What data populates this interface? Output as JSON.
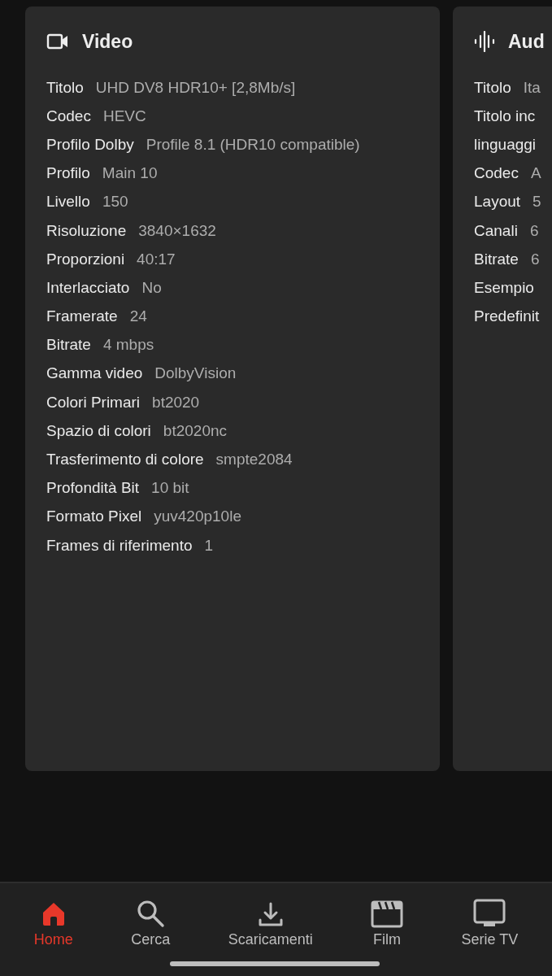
{
  "cards": [
    {
      "kind": "video",
      "title": "Video",
      "rows": [
        {
          "label": "Titolo",
          "value": "UHD DV8 HDR10+ [2,8Mb/s]"
        },
        {
          "label": "Codec",
          "value": "HEVC"
        },
        {
          "label": "Profilo Dolby",
          "value": "Profile 8.1 (HDR10 compatible)"
        },
        {
          "label": "Profilo",
          "value": "Main 10"
        },
        {
          "label": "Livello",
          "value": "150"
        },
        {
          "label": "Risoluzione",
          "value": "3840×1632"
        },
        {
          "label": "Proporzioni",
          "value": "40:17"
        },
        {
          "label": "Interlacciato",
          "value": "No"
        },
        {
          "label": "Framerate",
          "value": "24"
        },
        {
          "label": "Bitrate",
          "value": "4 mbps"
        },
        {
          "label": "Gamma video",
          "value": "DolbyVision"
        },
        {
          "label": "Colori Primari",
          "value": "bt2020"
        },
        {
          "label": "Spazio di colori",
          "value": "bt2020nc"
        },
        {
          "label": "Trasferimento di colore",
          "value": "smpte2084"
        },
        {
          "label": "Profondità Bit",
          "value": "10 bit"
        },
        {
          "label": "Formato Pixel",
          "value": "yuv420p10le"
        },
        {
          "label": "Frames di riferimento",
          "value": "1"
        }
      ]
    },
    {
      "kind": "audio",
      "title": "Aud",
      "rows": [
        {
          "label": "Titolo",
          "value": "Ita"
        },
        {
          "label": "Titolo inc"
        },
        {
          "label": "linguaggi"
        },
        {
          "label": "Codec",
          "value": "A"
        },
        {
          "label": "Layout",
          "value": "5"
        },
        {
          "label": "Canali",
          "value": "6"
        },
        {
          "label": "Bitrate",
          "value": "6"
        },
        {
          "label": "Esempio"
        },
        {
          "label": "Predefinit"
        }
      ]
    }
  ],
  "nav": [
    {
      "kind": "home",
      "label": "Home",
      "selected": true
    },
    {
      "kind": "search",
      "label": "Cerca",
      "selected": false
    },
    {
      "kind": "download",
      "label": "Scaricamenti",
      "selected": false
    },
    {
      "kind": "film",
      "label": "Film",
      "selected": false
    },
    {
      "kind": "tv",
      "label": "Serie TV",
      "selected": false
    }
  ]
}
